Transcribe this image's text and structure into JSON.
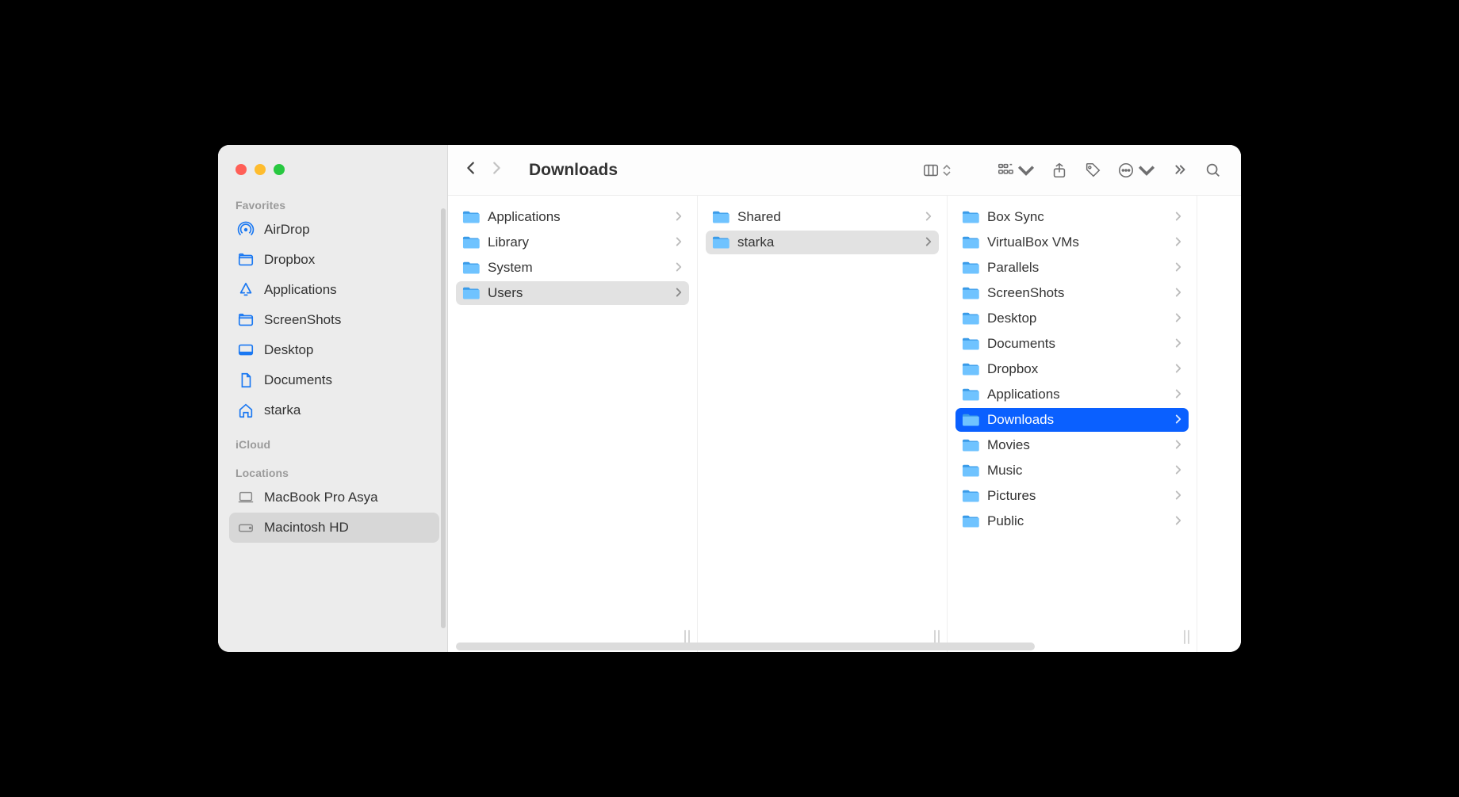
{
  "window": {
    "title": "Downloads"
  },
  "sidebar": {
    "sections": [
      {
        "heading": "Favorites",
        "items": [
          {
            "label": "AirDrop",
            "icon": "airdrop-icon",
            "muted": false
          },
          {
            "label": "Dropbox",
            "icon": "folder-icon",
            "muted": false
          },
          {
            "label": "Applications",
            "icon": "appstore-icon",
            "muted": false
          },
          {
            "label": "ScreenShots",
            "icon": "folder-icon",
            "muted": false
          },
          {
            "label": "Desktop",
            "icon": "desktop-icon",
            "muted": false
          },
          {
            "label": "Documents",
            "icon": "document-icon",
            "muted": false
          },
          {
            "label": "starka",
            "icon": "home-icon",
            "muted": false
          }
        ]
      },
      {
        "heading": "iCloud",
        "items": []
      },
      {
        "heading": "Locations",
        "items": [
          {
            "label": "MacBook Pro Asya",
            "icon": "laptop-icon",
            "muted": true
          },
          {
            "label": "Macintosh HD",
            "icon": "disk-icon",
            "muted": true,
            "selected": true
          }
        ]
      }
    ]
  },
  "columns": [
    {
      "items": [
        {
          "label": "Applications",
          "icon": "folder"
        },
        {
          "label": "Library",
          "icon": "folder"
        },
        {
          "label": "System",
          "icon": "folder"
        },
        {
          "label": "Users",
          "icon": "folder-users",
          "selected": "gray"
        }
      ]
    },
    {
      "items": [
        {
          "label": "Shared",
          "icon": "folder"
        },
        {
          "label": "starka",
          "icon": "folder-home",
          "selected": "gray"
        }
      ]
    },
    {
      "items": [
        {
          "label": "Box Sync",
          "icon": "folder"
        },
        {
          "label": "VirtualBox VMs",
          "icon": "folder"
        },
        {
          "label": "Parallels",
          "icon": "folder"
        },
        {
          "label": "ScreenShots",
          "icon": "folder"
        },
        {
          "label": "Desktop",
          "icon": "folder"
        },
        {
          "label": "Documents",
          "icon": "folder"
        },
        {
          "label": "Dropbox",
          "icon": "folder-dropbox"
        },
        {
          "label": "Applications",
          "icon": "folder"
        },
        {
          "label": "Downloads",
          "icon": "folder-downloads",
          "selected": "blue"
        },
        {
          "label": "Movies",
          "icon": "folder"
        },
        {
          "label": "Music",
          "icon": "folder"
        },
        {
          "label": "Pictures",
          "icon": "folder"
        },
        {
          "label": "Public",
          "icon": "folder"
        }
      ]
    }
  ]
}
